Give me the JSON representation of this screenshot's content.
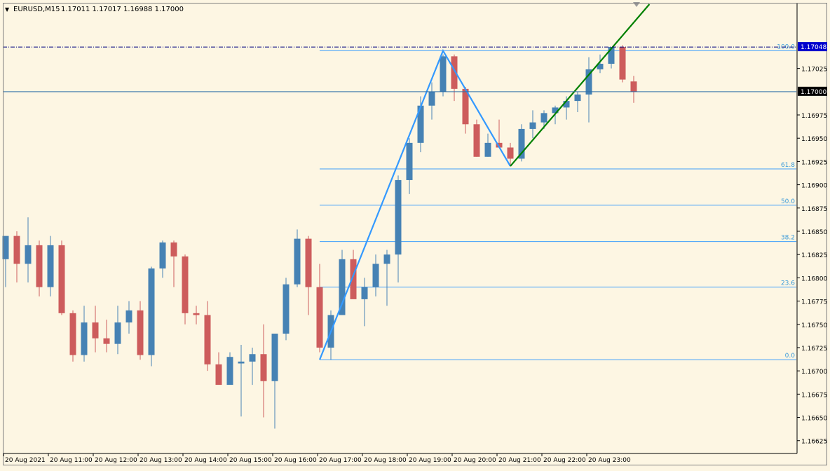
{
  "header": {
    "menu_glyph": "▼",
    "symbol": "EURUSD,M15",
    "ohlc": "1.17011 1.17017 1.16988 1.17000"
  },
  "colors": {
    "background": "#fdf6e3",
    "bull": "#4682b4",
    "bear": "#cd5c5c",
    "fib": "#1e90ff",
    "fib_text": "#3a9ad9",
    "zigzag": "#3399ff",
    "trend": "#008000",
    "bid_line": "#2f6fa8",
    "ask_line": "#000080",
    "ask_box": "#0000cd",
    "price_box": "#000000",
    "axis_text": "#000000"
  },
  "chart_data": {
    "type": "candlestick",
    "timeframe": "M15",
    "symbol": "EURUSD",
    "ylim": [
      1.16612,
      1.17094
    ],
    "y_ticks": [
      "1.17025",
      "1.16975",
      "1.16950",
      "1.16925",
      "1.16900",
      "1.16875",
      "1.16850",
      "1.16825",
      "1.16800",
      "1.16775",
      "1.16750",
      "1.16725",
      "1.16700",
      "1.16675",
      "1.16650",
      "1.16625"
    ],
    "x_labels": [
      "20 Aug 2021",
      "20 Aug 11:00",
      "20 Aug 12:00",
      "20 Aug 13:00",
      "20 Aug 14:00",
      "20 Aug 15:00",
      "20 Aug 16:00",
      "20 Aug 17:00",
      "20 Aug 18:00",
      "20 Aug 19:00",
      "20 Aug 20:00",
      "20 Aug 21:00",
      "20 Aug 22:00",
      "20 Aug 23:00"
    ],
    "current_price": "1.17000",
    "ask_price": "1.17048",
    "candles": [
      {
        "o": 1.1682,
        "h": 1.1684,
        "l": 1.1679,
        "c": 1.16845
      },
      {
        "o": 1.16845,
        "h": 1.1685,
        "l": 1.16795,
        "c": 1.16815
      },
      {
        "o": 1.16815,
        "h": 1.16865,
        "l": 1.16795,
        "c": 1.16835
      },
      {
        "o": 1.16835,
        "h": 1.1684,
        "l": 1.1678,
        "c": 1.1679
      },
      {
        "o": 1.1679,
        "h": 1.16845,
        "l": 1.1678,
        "c": 1.16835
      },
      {
        "o": 1.16835,
        "h": 1.1684,
        "l": 1.1676,
        "c": 1.16762
      },
      {
        "o": 1.16762,
        "h": 1.16765,
        "l": 1.1671,
        "c": 1.16717
      },
      {
        "o": 1.16717,
        "h": 1.1677,
        "l": 1.1671,
        "c": 1.16752
      },
      {
        "o": 1.16752,
        "h": 1.1677,
        "l": 1.1672,
        "c": 1.16735
      },
      {
        "o": 1.16735,
        "h": 1.16755,
        "l": 1.1672,
        "c": 1.16729
      },
      {
        "o": 1.16729,
        "h": 1.1677,
        "l": 1.16718,
        "c": 1.16752
      },
      {
        "o": 1.16752,
        "h": 1.16775,
        "l": 1.1674,
        "c": 1.16765
      },
      {
        "o": 1.16765,
        "h": 1.16775,
        "l": 1.16712,
        "c": 1.16717
      },
      {
        "o": 1.16717,
        "h": 1.16812,
        "l": 1.16705,
        "c": 1.1681
      },
      {
        "o": 1.1681,
        "h": 1.1684,
        "l": 1.168,
        "c": 1.16838
      },
      {
        "o": 1.16838,
        "h": 1.1684,
        "l": 1.1679,
        "c": 1.16823
      },
      {
        "o": 1.16823,
        "h": 1.16825,
        "l": 1.1675,
        "c": 1.16762
      },
      {
        "o": 1.16762,
        "h": 1.1677,
        "l": 1.1675,
        "c": 1.1676
      },
      {
        "o": 1.1676,
        "h": 1.16775,
        "l": 1.167,
        "c": 1.16707
      },
      {
        "o": 1.16707,
        "h": 1.1672,
        "l": 1.1669,
        "c": 1.16685
      },
      {
        "o": 1.16685,
        "h": 1.1672,
        "l": 1.1669,
        "c": 1.16715
      },
      {
        "o": 1.16708,
        "h": 1.16728,
        "l": 1.16651,
        "c": 1.1671
      },
      {
        "o": 1.1671,
        "h": 1.16725,
        "l": 1.16685,
        "c": 1.16718
      },
      {
        "o": 1.16718,
        "h": 1.1675,
        "l": 1.1665,
        "c": 1.16689
      },
      {
        "o": 1.16689,
        "h": 1.16735,
        "l": 1.16638,
        "c": 1.1674
      },
      {
        "o": 1.1674,
        "h": 1.168,
        "l": 1.16733,
        "c": 1.16793
      },
      {
        "o": 1.16793,
        "h": 1.16852,
        "l": 1.1679,
        "c": 1.16842
      },
      {
        "o": 1.16842,
        "h": 1.16845,
        "l": 1.1676,
        "c": 1.1679
      },
      {
        "o": 1.1679,
        "h": 1.16815,
        "l": 1.1672,
        "c": 1.16725
      },
      {
        "o": 1.16725,
        "h": 1.16765,
        "l": 1.16712,
        "c": 1.1676
      },
      {
        "o": 1.1676,
        "h": 1.1683,
        "l": 1.1676,
        "c": 1.1682
      },
      {
        "o": 1.1682,
        "h": 1.1683,
        "l": 1.1678,
        "c": 1.16777
      },
      {
        "o": 1.16777,
        "h": 1.168,
        "l": 1.16748,
        "c": 1.1679
      },
      {
        "o": 1.1679,
        "h": 1.16825,
        "l": 1.1678,
        "c": 1.16815
      },
      {
        "o": 1.16815,
        "h": 1.1683,
        "l": 1.1677,
        "c": 1.16825
      },
      {
        "o": 1.16825,
        "h": 1.1691,
        "l": 1.16795,
        "c": 1.16905
      },
      {
        "o": 1.16905,
        "h": 1.1695,
        "l": 1.1689,
        "c": 1.16945
      },
      {
        "o": 1.16945,
        "h": 1.16995,
        "l": 1.16935,
        "c": 1.16985
      },
      {
        "o": 1.16985,
        "h": 1.1701,
        "l": 1.1697,
        "c": 1.17
      },
      {
        "o": 1.17,
        "h": 1.1704,
        "l": 1.16995,
        "c": 1.17038
      },
      {
        "o": 1.17038,
        "h": 1.1704,
        "l": 1.1699,
        "c": 1.17003
      },
      {
        "o": 1.17003,
        "h": 1.17005,
        "l": 1.16955,
        "c": 1.16965
      },
      {
        "o": 1.16965,
        "h": 1.1697,
        "l": 1.1693,
        "c": 1.1693
      },
      {
        "o": 1.1693,
        "h": 1.16955,
        "l": 1.1693,
        "c": 1.16945
      },
      {
        "o": 1.16945,
        "h": 1.1697,
        "l": 1.1694,
        "c": 1.1694
      },
      {
        "o": 1.1694,
        "h": 1.16945,
        "l": 1.1692,
        "c": 1.16928
      },
      {
        "o": 1.16928,
        "h": 1.16965,
        "l": 1.16925,
        "c": 1.1696
      },
      {
        "o": 1.1696,
        "h": 1.1698,
        "l": 1.1695,
        "c": 1.16967
      },
      {
        "o": 1.16967,
        "h": 1.1698,
        "l": 1.1696,
        "c": 1.16977
      },
      {
        "o": 1.16977,
        "h": 1.16985,
        "l": 1.16965,
        "c": 1.16983
      },
      {
        "o": 1.16983,
        "h": 1.16995,
        "l": 1.1697,
        "c": 1.1699
      },
      {
        "o": 1.1699,
        "h": 1.17,
        "l": 1.16978,
        "c": 1.16997
      },
      {
        "o": 1.16997,
        "h": 1.17037,
        "l": 1.16967,
        "c": 1.17024
      },
      {
        "o": 1.17024,
        "h": 1.1704,
        "l": 1.1702,
        "c": 1.1703
      },
      {
        "o": 1.1703,
        "h": 1.17048,
        "l": 1.17025,
        "c": 1.17048
      },
      {
        "o": 1.17048,
        "h": 1.1705,
        "l": 1.1701,
        "c": 1.17013
      },
      {
        "o": 1.17011,
        "h": 1.17017,
        "l": 1.16988,
        "c": 1.17
      }
    ],
    "fibonacci": {
      "levels": [
        {
          "label": "100.0",
          "price": 1.17044
        },
        {
          "label": "61.8",
          "price": 1.16917
        },
        {
          "label": "50.0",
          "price": 1.16878
        },
        {
          "label": "38.2",
          "price": 1.16839
        },
        {
          "label": "23.6",
          "price": 1.1679
        },
        {
          "label": "0.0",
          "price": 1.16712
        }
      ]
    },
    "zigzag": [
      {
        "bar": 28,
        "price": 1.16712
      },
      {
        "bar": 39,
        "price": 1.17044
      },
      {
        "bar": 45,
        "price": 1.1692
      }
    ],
    "trendline": [
      {
        "bar": 45,
        "price": 1.1692
      },
      {
        "bar": 57.4,
        "price": 1.17094
      }
    ]
  }
}
